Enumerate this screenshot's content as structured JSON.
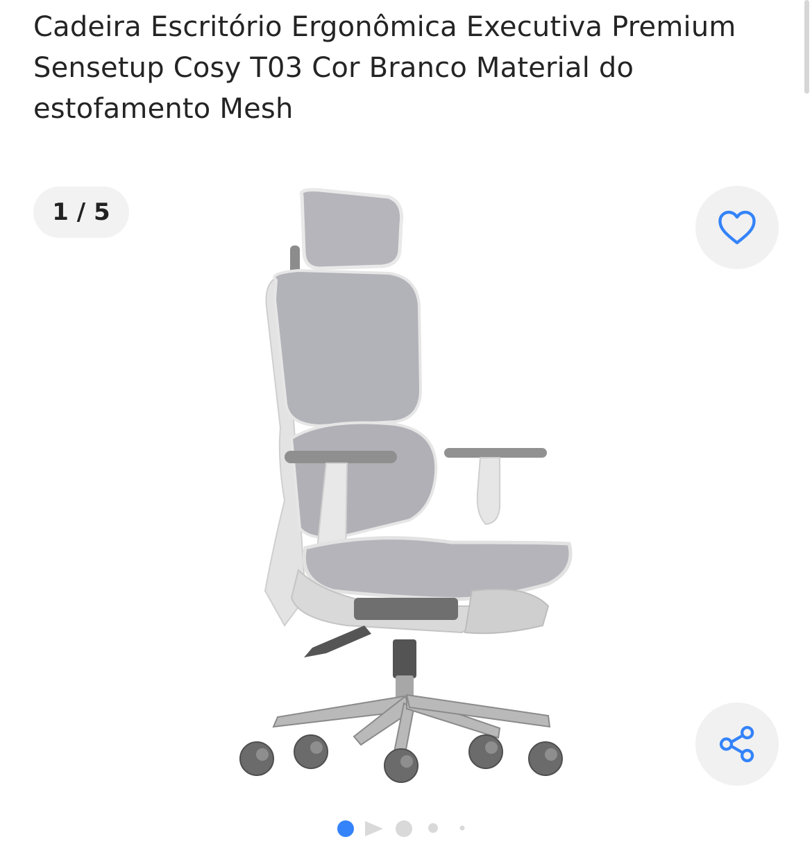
{
  "product": {
    "title": "Cadeira Escritório Ergonômica Executiva Premium Sensetup Cosy T03 Cor Branco Material do estofamento Mesh"
  },
  "gallery": {
    "counter": "1 / 5",
    "current_index": 1,
    "total": 5
  },
  "icons": {
    "favorite": "heart-outline-icon",
    "share": "share-icon"
  },
  "colors": {
    "accent": "#3483fa",
    "button_bg": "#f1f1f1",
    "inactive_dot": "#d9d9d9"
  }
}
